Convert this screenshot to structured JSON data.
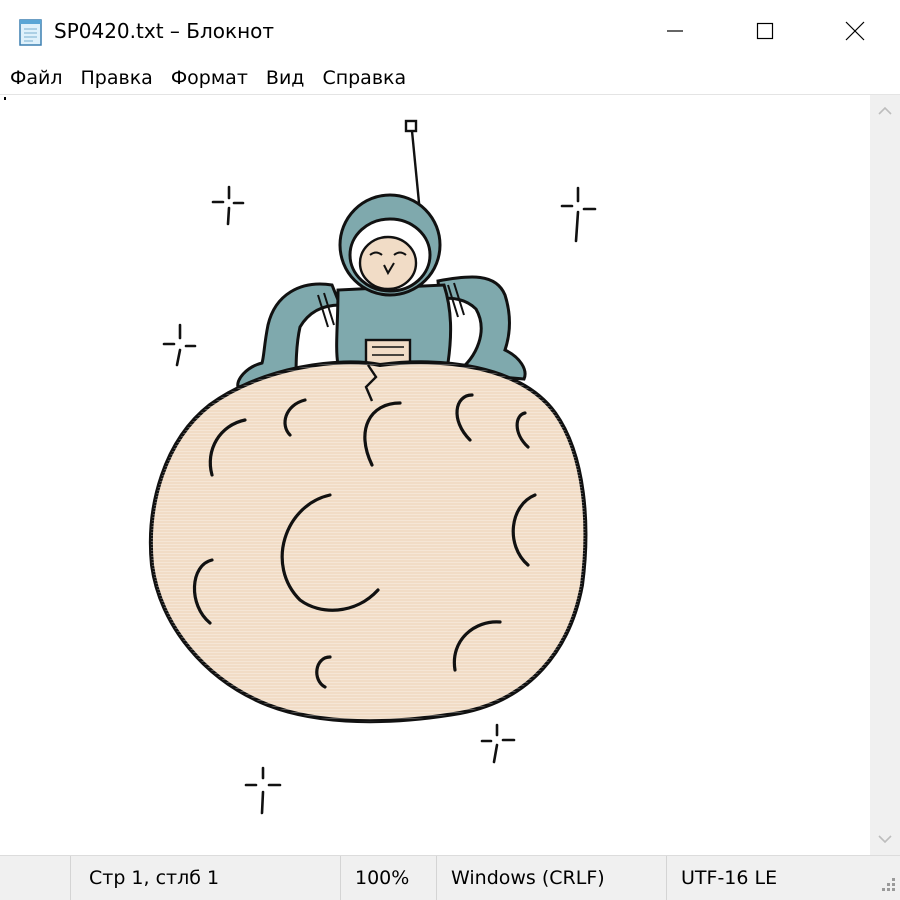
{
  "window": {
    "title": "SP0420.txt – Блокнот",
    "icon": "notepad-icon",
    "controls": {
      "minimize": "minimize-icon",
      "maximize": "maximize-icon",
      "close": "close-icon"
    }
  },
  "menu": {
    "items": [
      {
        "label": "Файл"
      },
      {
        "label": "Правка"
      },
      {
        "label": "Формат"
      },
      {
        "label": "Вид"
      },
      {
        "label": "Справка"
      }
    ]
  },
  "editor": {
    "content_picture": "astronaut-on-moon ascii art"
  },
  "status": {
    "position": "Стр 1, стлб 1",
    "zoom": "100%",
    "line_ending": "Windows (CRLF)",
    "encoding": "UTF-16 LE"
  },
  "colors": {
    "moon_fill": "#f1dcc6",
    "suit_fill": "#7fa9ad",
    "outline": "#111111",
    "scrollbar": "#f0f0f0",
    "statusbar": "#f0f0f0"
  }
}
